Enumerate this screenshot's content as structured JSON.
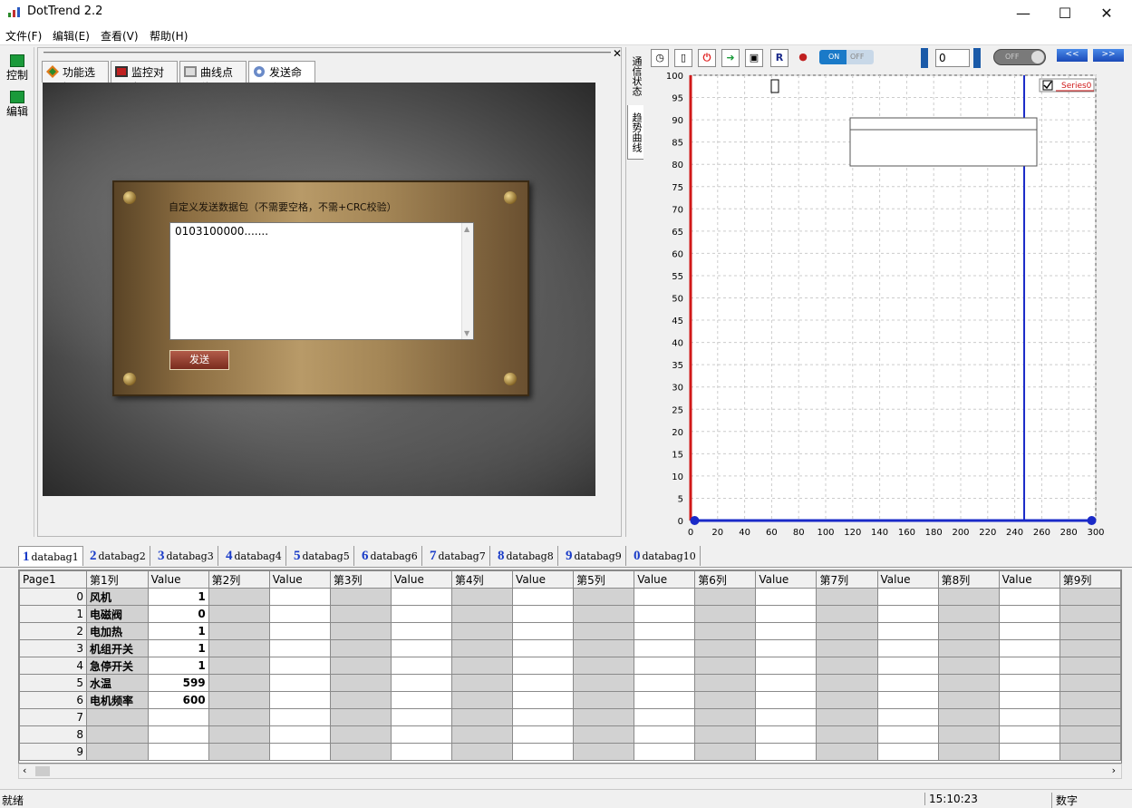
{
  "window": {
    "title": "DotTrend 2.2",
    "minimize": "—",
    "maximize": "☐",
    "close": "✕"
  },
  "menu": [
    "文件(F)",
    "编辑(E)",
    "查看(V)",
    "帮助(H)"
  ],
  "left_nav": {
    "control": "控制",
    "edit": "编辑"
  },
  "tabs": [
    "功能选择",
    "监控对象",
    "曲线点位",
    "发送命令"
  ],
  "send_panel": {
    "label": "自定义发送数据包（不需要空格，不需+CRC校验）",
    "payload": "0103100000.......",
    "send_button": "发送"
  },
  "vertical_tabs": [
    "通信状态",
    "趋势曲线"
  ],
  "toolbar": {
    "on_label": "ON",
    "off_label": "OFF",
    "spin_value": "0",
    "prev_label": "<<",
    "next_label": ">>",
    "r_label": "R"
  },
  "chart_data": {
    "type": "line",
    "series": [
      {
        "name": "Series0",
        "values": []
      }
    ],
    "xlim": [
      0,
      300
    ],
    "ylim": [
      0,
      100
    ],
    "xticks": [
      0,
      20,
      40,
      60,
      80,
      100,
      120,
      140,
      160,
      180,
      200,
      220,
      240,
      260,
      280,
      300
    ],
    "yticks": [
      0,
      5,
      10,
      15,
      20,
      25,
      30,
      35,
      40,
      45,
      50,
      55,
      60,
      65,
      70,
      75,
      80,
      85,
      90,
      95,
      100
    ],
    "cursor_x": 247,
    "grid": true,
    "legend": "top-right"
  },
  "databags": [
    "databag1",
    "databag2",
    "databag3",
    "databag4",
    "databag5",
    "databag6",
    "databag7",
    "databag8",
    "databag9",
    "databag10"
  ],
  "databag_nums": [
    "1",
    "2",
    "3",
    "4",
    "5",
    "6",
    "7",
    "8",
    "9",
    "0"
  ],
  "grid": {
    "corner": "Page1",
    "columns": [
      "第1列",
      "Value",
      "第2列",
      "Value",
      "第3列",
      "Value",
      "第4列",
      "Value",
      "第5列",
      "Value",
      "第6列",
      "Value",
      "第7列",
      "Value",
      "第8列",
      "Value",
      "第9列"
    ],
    "rows": [
      {
        "idx": "0",
        "name": "风机",
        "value": "1"
      },
      {
        "idx": "1",
        "name": "电磁阀",
        "value": "0"
      },
      {
        "idx": "2",
        "name": "电加热",
        "value": "1"
      },
      {
        "idx": "3",
        "name": "机组开关",
        "value": "1"
      },
      {
        "idx": "4",
        "name": "急停开关",
        "value": "1"
      },
      {
        "idx": "5",
        "name": "水温",
        "value": "599"
      },
      {
        "idx": "6",
        "name": "电机频率",
        "value": "600"
      },
      {
        "idx": "7",
        "name": "",
        "value": ""
      },
      {
        "idx": "8",
        "name": "",
        "value": ""
      },
      {
        "idx": "9",
        "name": "",
        "value": ""
      }
    ]
  },
  "status": {
    "left": "就绪",
    "time": "15:10:23",
    "mode": "数字"
  }
}
